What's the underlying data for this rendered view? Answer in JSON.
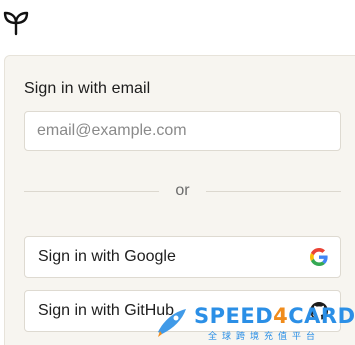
{
  "logo": {
    "icon": "sprout-icon"
  },
  "signin": {
    "title": "Sign in with email",
    "email_placeholder": "email@example.com",
    "email_value": "",
    "divider_text": "or",
    "google_label": "Sign in with Google",
    "github_label": "Sign in with GitHub"
  },
  "watermark": {
    "brand_part1": "SPEED",
    "brand_part2": "4",
    "brand_part3": "CARD",
    "tagline": "全球跨境充值平台"
  },
  "colors": {
    "card_background": "#f7f5f0",
    "watermark_blue": "#2b8fe6",
    "watermark_orange": "#f08c1c"
  }
}
